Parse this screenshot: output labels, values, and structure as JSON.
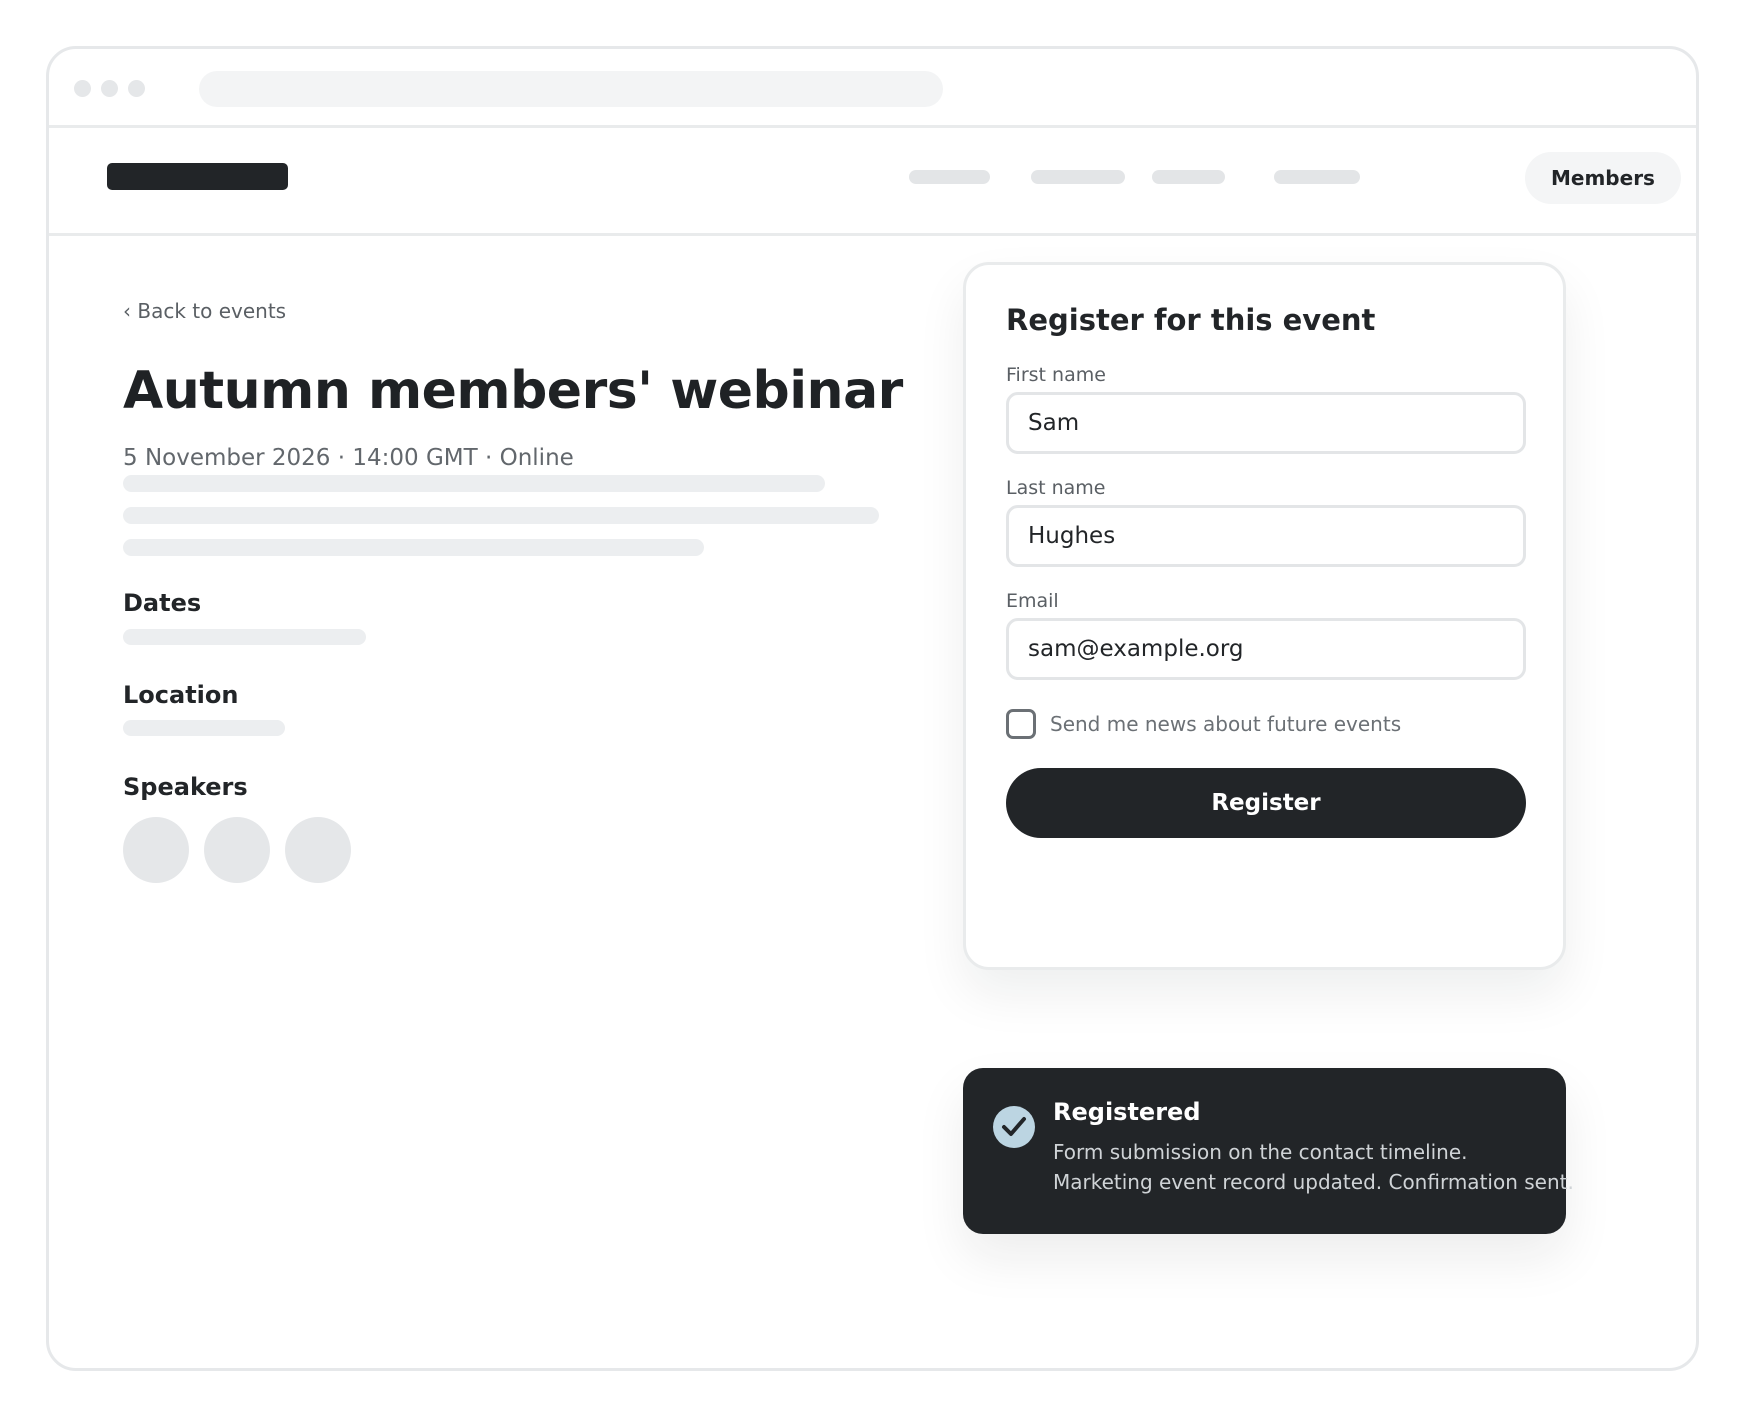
{
  "nav": {
    "members_label": "Members"
  },
  "event": {
    "back_link": "‹ Back to events",
    "title": "Autumn members' webinar",
    "meta": "5 November 2026 · 14:00 GMT · Online",
    "sections": {
      "dates": "Dates",
      "location": "Location",
      "speakers": "Speakers"
    }
  },
  "form": {
    "title": "Register for this event",
    "first_name": {
      "label": "First name",
      "value": "Sam"
    },
    "last_name": {
      "label": "Last name",
      "value": "Hughes"
    },
    "email": {
      "label": "Email",
      "value": "sam@example.org"
    },
    "newsletter": {
      "label": "Send me news about future events",
      "checked": false
    },
    "submit_label": "Register"
  },
  "toast": {
    "title": "Registered",
    "line1": "Form submission on the contact timeline.",
    "line2": "Marketing event record updated. Confirmation sent.",
    "icon": "check-circle-icon"
  },
  "colors": {
    "primary": "#222528",
    "success_icon_bg": "#bcd5e2",
    "placeholder": "#eceef0"
  }
}
